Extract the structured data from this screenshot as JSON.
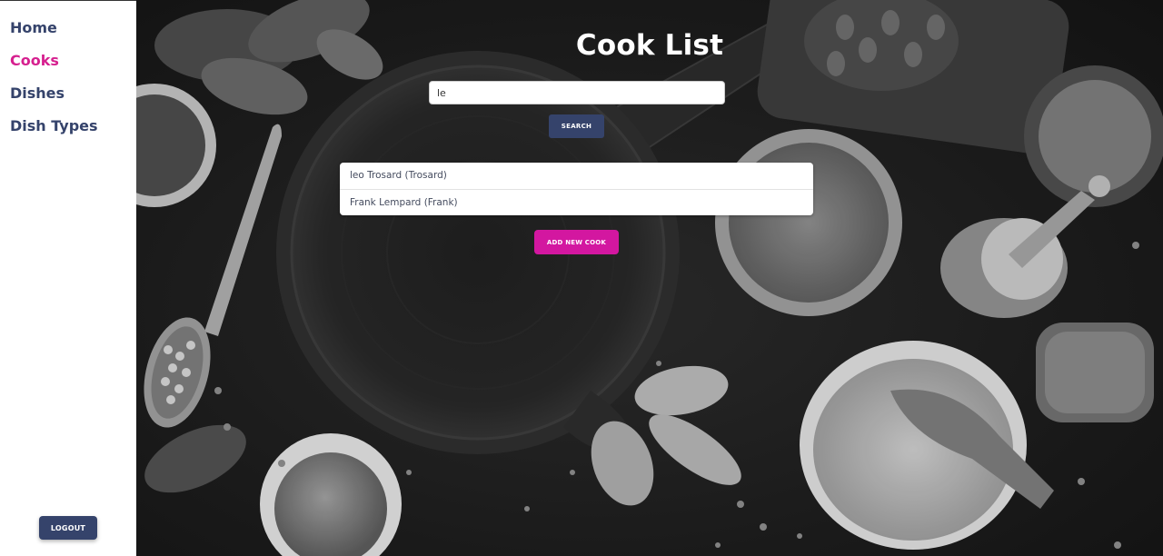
{
  "sidebar": {
    "items": [
      {
        "label": "Home",
        "active": false
      },
      {
        "label": "Cooks",
        "active": true
      },
      {
        "label": "Dishes",
        "active": false
      },
      {
        "label": "Dish Types",
        "active": false
      }
    ],
    "logout_label": "LOGOUT"
  },
  "main": {
    "title": "Cook List",
    "search": {
      "value": "le",
      "button_label": "SEARCH"
    },
    "results": [
      {
        "text": "leo Trosard (Trosard)"
      },
      {
        "text": "Frank Lempard (Frank)"
      }
    ],
    "add_button_label": "ADD NEW COOK"
  },
  "colors": {
    "navy": "#35436b",
    "accent_pink": "#d6208f",
    "add_button": "#d317a0"
  },
  "background": "grayscale-kitchen-photo: cast-iron pan, spice bowls, spoons, bay leaves, lentils, pepper grinder"
}
